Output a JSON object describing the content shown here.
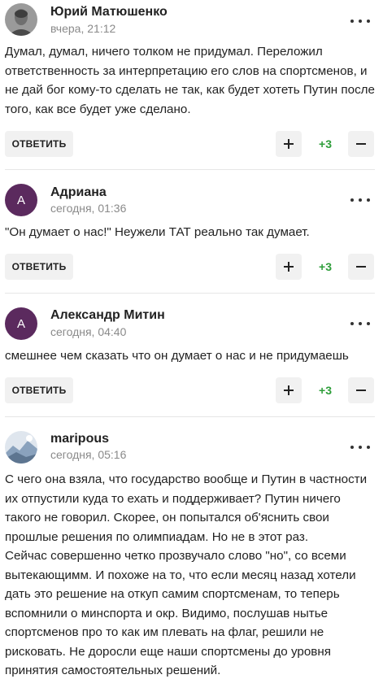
{
  "comments": [
    {
      "author": "Юрий Матюшенко",
      "time": "вчера, 21:12",
      "avatar": "photo",
      "text": "Думал, думал, ничего толком не придумал. Переложил ответственность за интерпретацию его слов на спортсменов, и не дай бог кому-то сделать не так, как будет хотеть Путин после того, как все будет уже сделано.",
      "reply_label": "ОТВЕТИТЬ",
      "score": "+3"
    },
    {
      "author": "Адриана",
      "time": "сегодня, 01:36",
      "avatar": "А",
      "text": "\"Он думает о нас!\" Неужели ТАТ реально так думает.",
      "reply_label": "ОТВЕТИТЬ",
      "score": "+3"
    },
    {
      "author": "Александр Митин",
      "time": "сегодня, 04:40",
      "avatar": "А",
      "text": "смешнее чем сказать что он думает о нас и не придумаешь",
      "reply_label": "ОТВЕТИТЬ",
      "score": "+3"
    },
    {
      "author": "maripous",
      "time": "сегодня, 05:16",
      "avatar": "photo",
      "text": "С чего она взяла, что государство вообще и Путин в частности их отпустили куда то ехать и поддерживает? Путин ничего такого не говорил. Скорее, он попытался об'яснить свои прошлые решения по олимпиадам. Но не в этот раз.",
      "text2": "Сейчас совершенно четко прозвучало слово \"но\", со всеми вытекающимм. И похоже на то, что если месяц назад хотели дать это решение на откуп самим спортсменам, то теперь вспомнили о минспорта и окр. Видимо, послушав нытье спортсменов про то как им плевать на флаг, решили не рисковать. Не доросли еще наши спортсмены до уровня принятия самостоятельных решений."
    }
  ],
  "icons": {
    "more": "more-dots-icon",
    "upvote": "plus-icon",
    "downvote": "minus-icon"
  },
  "colors": {
    "score": "#2e9e3a",
    "letter_avatar": "#5b2a5e",
    "button_bg": "#f1f1f1"
  }
}
